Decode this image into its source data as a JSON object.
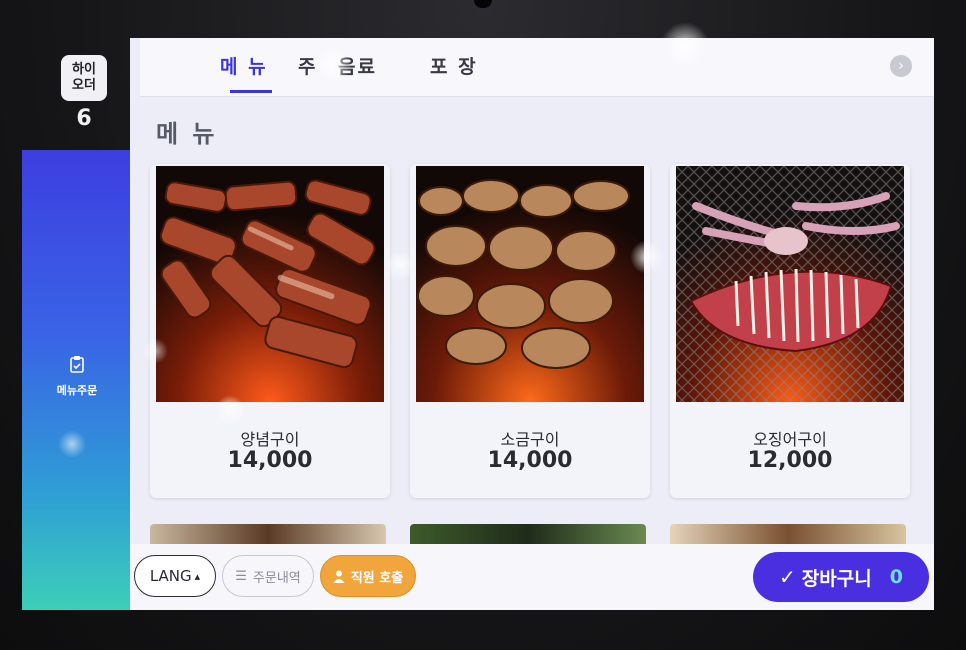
{
  "app": {
    "brand": "하이\n오더",
    "table_number": "6"
  },
  "sidebar": {
    "items": [
      {
        "label": "메뉴주문",
        "icon": "clipboard-icon"
      }
    ]
  },
  "tabs": [
    {
      "label": "메 뉴",
      "active": true
    },
    {
      "label": "주 ",
      "active": false
    },
    {
      "label": "음료",
      "active": false
    },
    {
      "label": "포 장",
      "active": false
    }
  ],
  "section": {
    "title": "메 뉴"
  },
  "menu": {
    "items": [
      {
        "name": "양념구이",
        "price": "14,000"
      },
      {
        "name": "소금구이",
        "price": "14,000"
      },
      {
        "name": "오징어구이",
        "price": "12,000"
      }
    ]
  },
  "bottom": {
    "lang_label": "LANG",
    "lang_arrow": "▴",
    "history_label": "주문내역",
    "history_icon": "☰",
    "staff_label": "직원 호출",
    "staff_icon": "person-icon",
    "cart_label": "장바구니",
    "cart_count": "0",
    "cart_check": "✓"
  },
  "colors": {
    "accent": "#3a35d6",
    "cart": "#4a2fe0",
    "staff": "#f0a53d",
    "cart_count": "#6ee0f2"
  }
}
